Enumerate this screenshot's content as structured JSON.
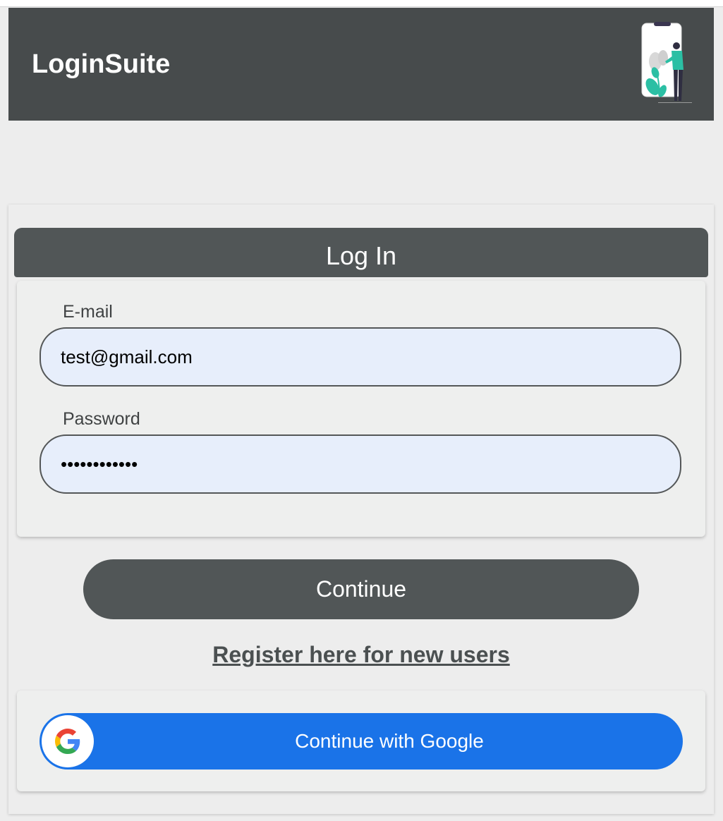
{
  "header": {
    "brand": "LoginSuite",
    "illustration_icon": "person-with-phone-illustration"
  },
  "login": {
    "title": "Log In",
    "email": {
      "label": "E-mail",
      "value": "test@gmail.com"
    },
    "password": {
      "label": "Password",
      "value": "••••••••••••"
    },
    "continue_label": "Continue",
    "register_label": "Register here for new users",
    "google": {
      "label": "Continue with Google",
      "icon": "google-g-icon"
    }
  },
  "colors": {
    "header_bg": "#474b4c",
    "primary_dark": "#515657",
    "page_bg": "#ededed",
    "input_bg": "#e7eefb",
    "google_blue": "#1a73e8",
    "illustration_accent": "#2bbfa4"
  }
}
